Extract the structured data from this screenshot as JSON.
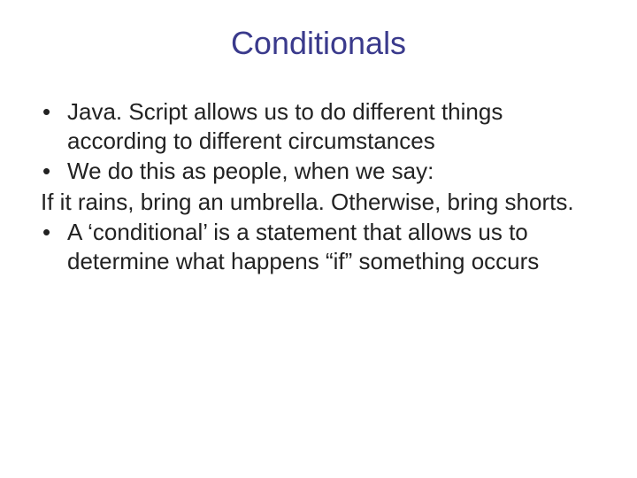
{
  "slide": {
    "title": "Conditionals",
    "lines": [
      {
        "kind": "bullet",
        "text": "Java. Script allows us to do different things according to different circumstances"
      },
      {
        "kind": "bullet",
        "text": "We do this as people, when we say:"
      },
      {
        "kind": "plain",
        "text": "If it rains, bring an umbrella.  Otherwise, bring shorts."
      },
      {
        "kind": "bullet",
        "text": "A ‘conditional’ is a statement that allows us to determine what happens “if” something occurs"
      }
    ],
    "bullet_glyph": "•"
  }
}
